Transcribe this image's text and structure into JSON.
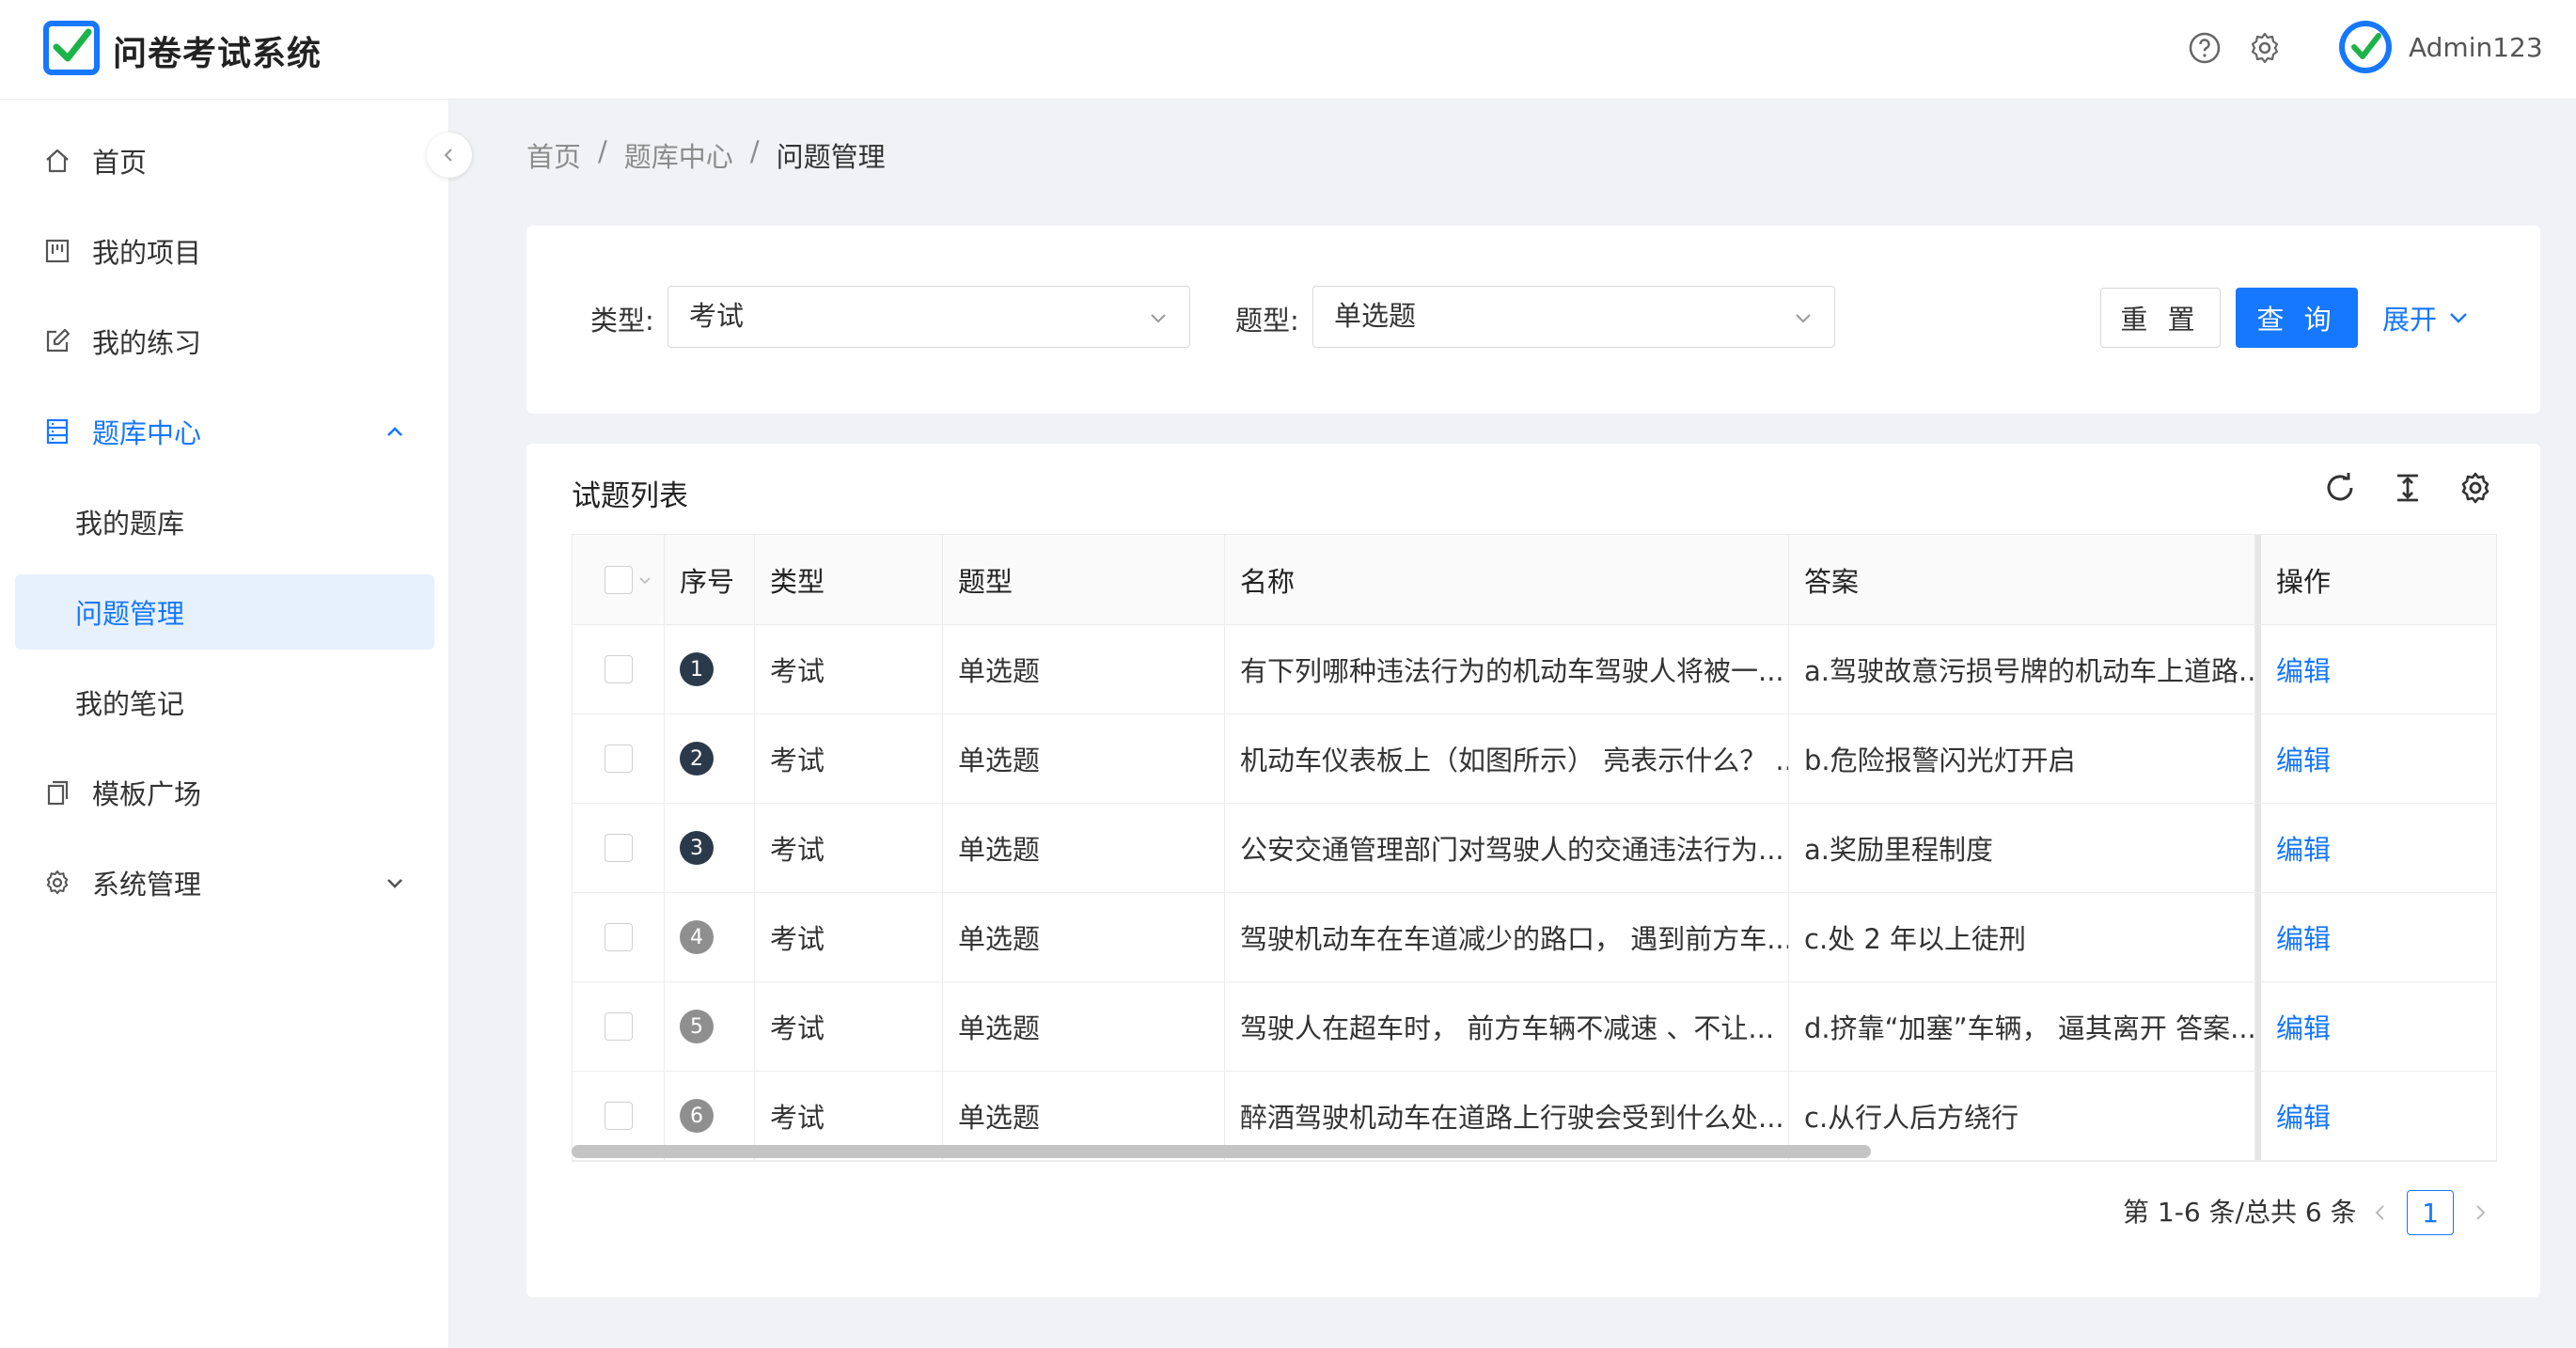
{
  "app": {
    "title": "问卷考试系统",
    "username": "Admin123",
    "brand_color": "#1677ff"
  },
  "sidebar": {
    "items": [
      {
        "label": "首页",
        "icon": "home-icon"
      },
      {
        "label": "我的项目",
        "icon": "project-icon"
      },
      {
        "label": "我的练习",
        "icon": "edit-icon"
      },
      {
        "label": "题库中心",
        "icon": "database-icon",
        "expanded": true,
        "children": [
          {
            "label": "我的题库"
          },
          {
            "label": "问题管理",
            "active": true
          },
          {
            "label": "我的笔记"
          }
        ]
      },
      {
        "label": "模板广场",
        "icon": "copy-icon"
      },
      {
        "label": "系统管理",
        "icon": "gear-icon"
      }
    ]
  },
  "breadcrumb": {
    "items": [
      "首页",
      "题库中心",
      "问题管理"
    ],
    "separator": "/"
  },
  "filters": {
    "type_label": "类型:",
    "type_value": "考试",
    "qtype_label": "题型:",
    "qtype_value": "单选题",
    "reset_label": "重 置",
    "query_label": "查 询",
    "expand_label": "展开"
  },
  "table": {
    "title": "试题列表",
    "columns": [
      "序号",
      "类型",
      "题型",
      "名称",
      "答案",
      "操作"
    ],
    "rows": [
      {
        "idx": "1",
        "type": "考试",
        "qtype": "单选题",
        "name": "有下列哪种违法行为的机动车驾驶人将被一...",
        "answer": "a.驾驶故意污损号牌的机动车上道路...",
        "action": "编辑"
      },
      {
        "idx": "2",
        "type": "考试",
        "qtype": "单选题",
        "name": "机动车仪表板上（如图所示） 亮表示什么？ ...",
        "answer": "b.危险报警闪光灯开启",
        "action": "编辑"
      },
      {
        "idx": "3",
        "type": "考试",
        "qtype": "单选题",
        "name": "公安交通管理部门对驾驶人的交通违法行为...",
        "answer": "a.奖励里程制度",
        "action": "编辑"
      },
      {
        "idx": "4",
        "type": "考试",
        "qtype": "单选题",
        "name": "驾驶机动车在车道减少的路口， 遇到前方车...",
        "answer": "c.处 2 年以上徒刑",
        "action": "编辑"
      },
      {
        "idx": "5",
        "type": "考试",
        "qtype": "单选题",
        "name": "驾驶人在超车时， 前方车辆不减速 、不让...",
        "answer": "d.挤靠“加塞”车辆， 逼其离开 答案...",
        "action": "编辑"
      },
      {
        "idx": "6",
        "type": "考试",
        "qtype": "单选题",
        "name": "醉酒驾驶机动车在道路上行驶会受到什么处...",
        "answer": "c.从行人后方绕行",
        "action": "编辑"
      }
    ]
  },
  "pagination": {
    "summary": "第 1-6 条/总共 6 条",
    "current_page": "1"
  }
}
